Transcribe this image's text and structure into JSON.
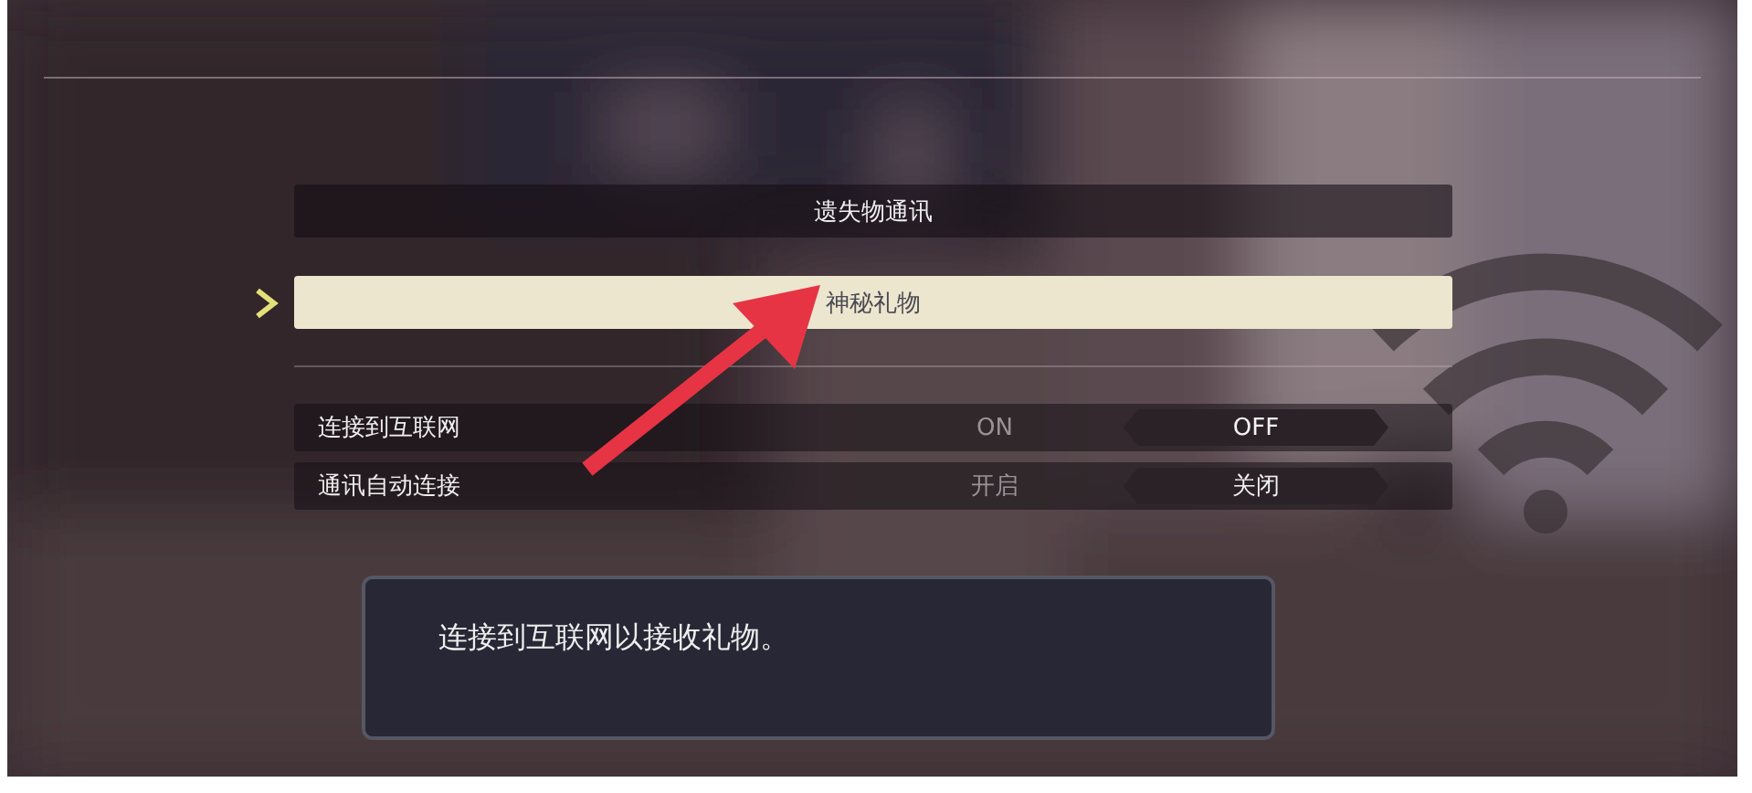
{
  "menu": [
    {
      "label": "遗失物通讯",
      "selected": false
    },
    {
      "label": "神秘礼物",
      "selected": true
    }
  ],
  "settings": [
    {
      "label": "连接到互联网",
      "options": [
        {
          "label": "ON",
          "selected": false
        },
        {
          "label": "OFF",
          "selected": true
        }
      ]
    },
    {
      "label": "通讯自动连接",
      "options": [
        {
          "label": "开启",
          "selected": false
        },
        {
          "label": "关闭",
          "selected": true
        }
      ]
    }
  ],
  "message": "连接到互联网以接收礼物。"
}
